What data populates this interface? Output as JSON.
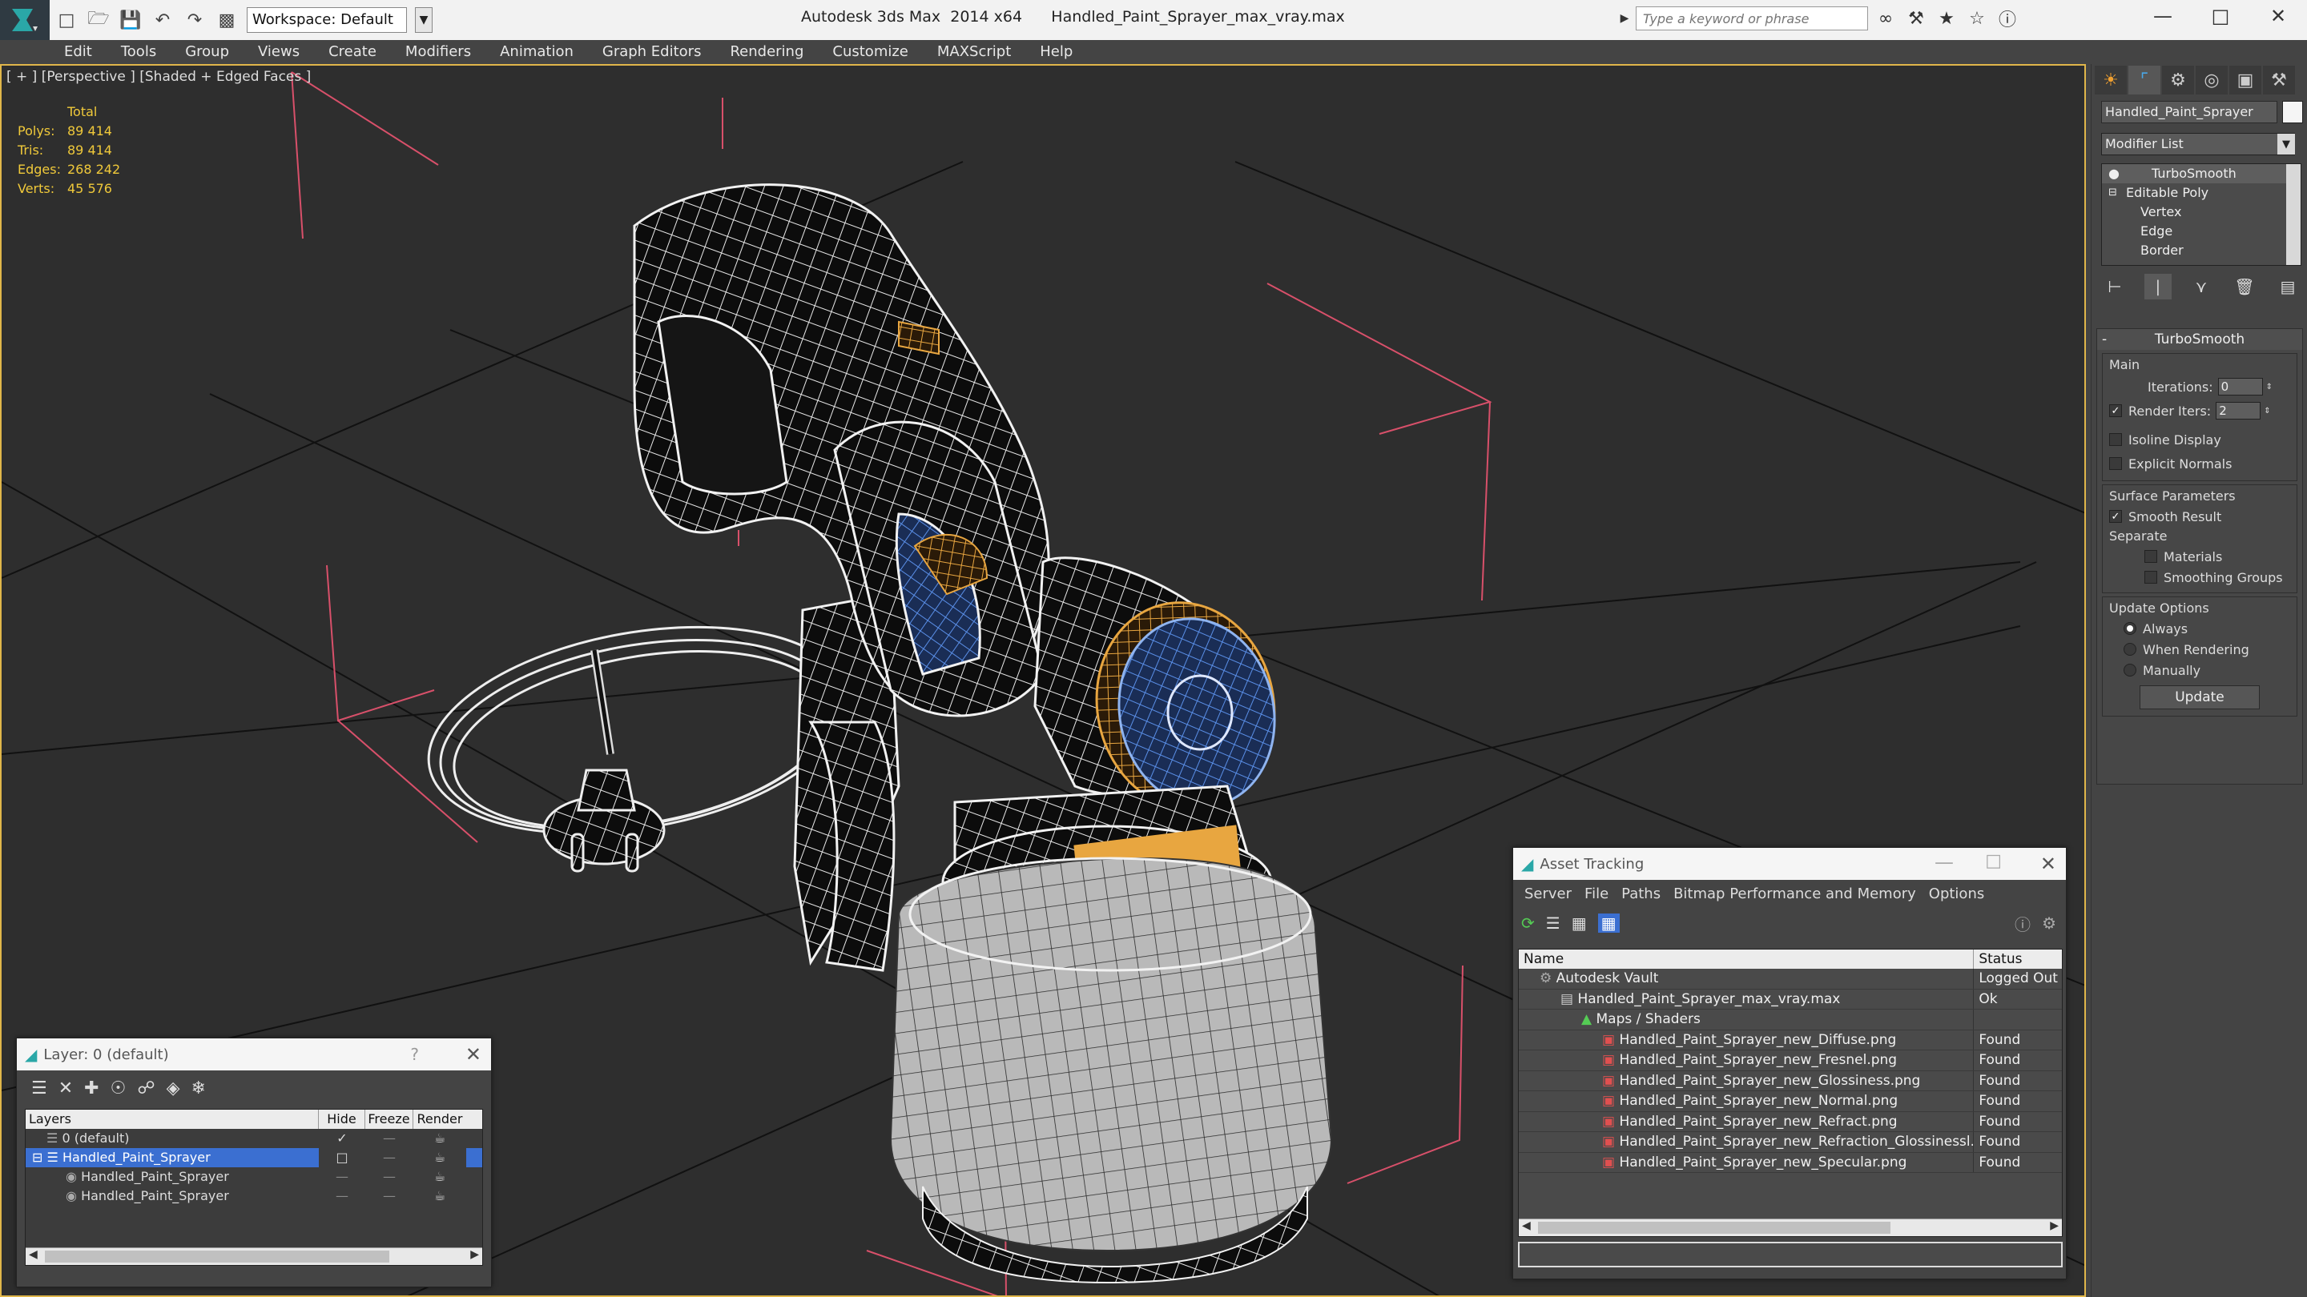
{
  "app": {
    "title": "Autodesk 3ds Max  2014 x64      Handled_Paint_Sprayer_max_vray.max",
    "workspace": "Workspace: Default",
    "search_placeholder": "Type a keyword or phrase"
  },
  "menu": [
    "Edit",
    "Tools",
    "Group",
    "Views",
    "Create",
    "Modifiers",
    "Animation",
    "Graph Editors",
    "Rendering",
    "Customize",
    "MAXScript",
    "Help"
  ],
  "viewport": {
    "label": "[ + ] [Perspective ] [Shaded + Edged Faces ]",
    "stats": {
      "header": "Total",
      "rows": [
        {
          "k": "Polys:",
          "v": "89 414"
        },
        {
          "k": "Tris:",
          "v": "89 414"
        },
        {
          "k": "Edges:",
          "v": "268 242"
        },
        {
          "k": "Verts:",
          "v": "45 576"
        }
      ]
    }
  },
  "command_panel": {
    "object_name": "Handled_Paint_Sprayer",
    "modifier_list": "Modifier List",
    "stack": [
      {
        "label": "TurboSmooth",
        "level": 0,
        "selected": true
      },
      {
        "label": "Editable Poly",
        "level": 0,
        "selected": false
      },
      {
        "label": "Vertex",
        "level": 1,
        "selected": false
      },
      {
        "label": "Edge",
        "level": 1,
        "selected": false
      },
      {
        "label": "Border",
        "level": 1,
        "selected": false
      }
    ],
    "turbosmooth": {
      "title": "TurboSmooth",
      "main_title": "Main",
      "iterations_label": "Iterations:",
      "iterations_value": "0",
      "render_iters_label": "Render Iters:",
      "render_iters_value": "2",
      "isoline_label": "Isoline Display",
      "explicit_normals_label": "Explicit Normals",
      "surface_title": "Surface Parameters",
      "smooth_result_label": "Smooth Result",
      "separate_title": "Separate",
      "materials_label": "Materials",
      "smoothing_groups_label": "Smoothing Groups",
      "update_title": "Update Options",
      "always_label": "Always",
      "when_rendering_label": "When Rendering",
      "manually_label": "Manually",
      "update_button": "Update"
    }
  },
  "layer_window": {
    "title": "Layer: 0 (default)",
    "help": "?",
    "columns": [
      "Layers",
      "Hide",
      "Freeze",
      "Render"
    ],
    "rows": [
      {
        "name": "0 (default)",
        "indent": 1,
        "selected": false,
        "current": true
      },
      {
        "name": "Handled_Paint_Sprayer",
        "indent": 1,
        "selected": true,
        "current": false
      },
      {
        "name": "Handled_Paint_Sprayer",
        "indent": 2,
        "selected": false,
        "current": false
      },
      {
        "name": "Handled_Paint_Sprayer",
        "indent": 2,
        "selected": false,
        "current": false
      }
    ]
  },
  "asset_window": {
    "title": "Asset Tracking",
    "menu": [
      "Server",
      "File",
      "Paths",
      "Bitmap Performance and Memory",
      "Options"
    ],
    "columns": [
      "Name",
      "Status"
    ],
    "rows": [
      {
        "name": "Autodesk Vault",
        "status": "Logged Out",
        "indent": 0
      },
      {
        "name": "Handled_Paint_Sprayer_max_vray.max",
        "status": "Ok",
        "indent": 1
      },
      {
        "name": "Maps / Shaders",
        "status": "",
        "indent": 2
      },
      {
        "name": "Handled_Paint_Sprayer_new_Diffuse.png",
        "status": "Found",
        "indent": 3
      },
      {
        "name": "Handled_Paint_Sprayer_new_Fresnel.png",
        "status": "Found",
        "indent": 3
      },
      {
        "name": "Handled_Paint_Sprayer_new_Glossiness.png",
        "status": "Found",
        "indent": 3
      },
      {
        "name": "Handled_Paint_Sprayer_new_Normal.png",
        "status": "Found",
        "indent": 3
      },
      {
        "name": "Handled_Paint_Sprayer_new_Refract.png",
        "status": "Found",
        "indent": 3
      },
      {
        "name": "Handled_Paint_Sprayer_new_Refraction_Glossinessl.png",
        "status": "Found",
        "indent": 3
      },
      {
        "name": "Handled_Paint_Sprayer_new_Specular.png",
        "status": "Found",
        "indent": 3
      }
    ]
  },
  "colors": {
    "viewport_border": "#e0b64a",
    "stats_text": "#f0c93a",
    "selection_blue": "#3b6fd1",
    "wire_white": "#ffffff",
    "wire_orange": "#e8a640",
    "wire_blue": "#4a7fd6",
    "bbox_red": "#d8506a"
  }
}
